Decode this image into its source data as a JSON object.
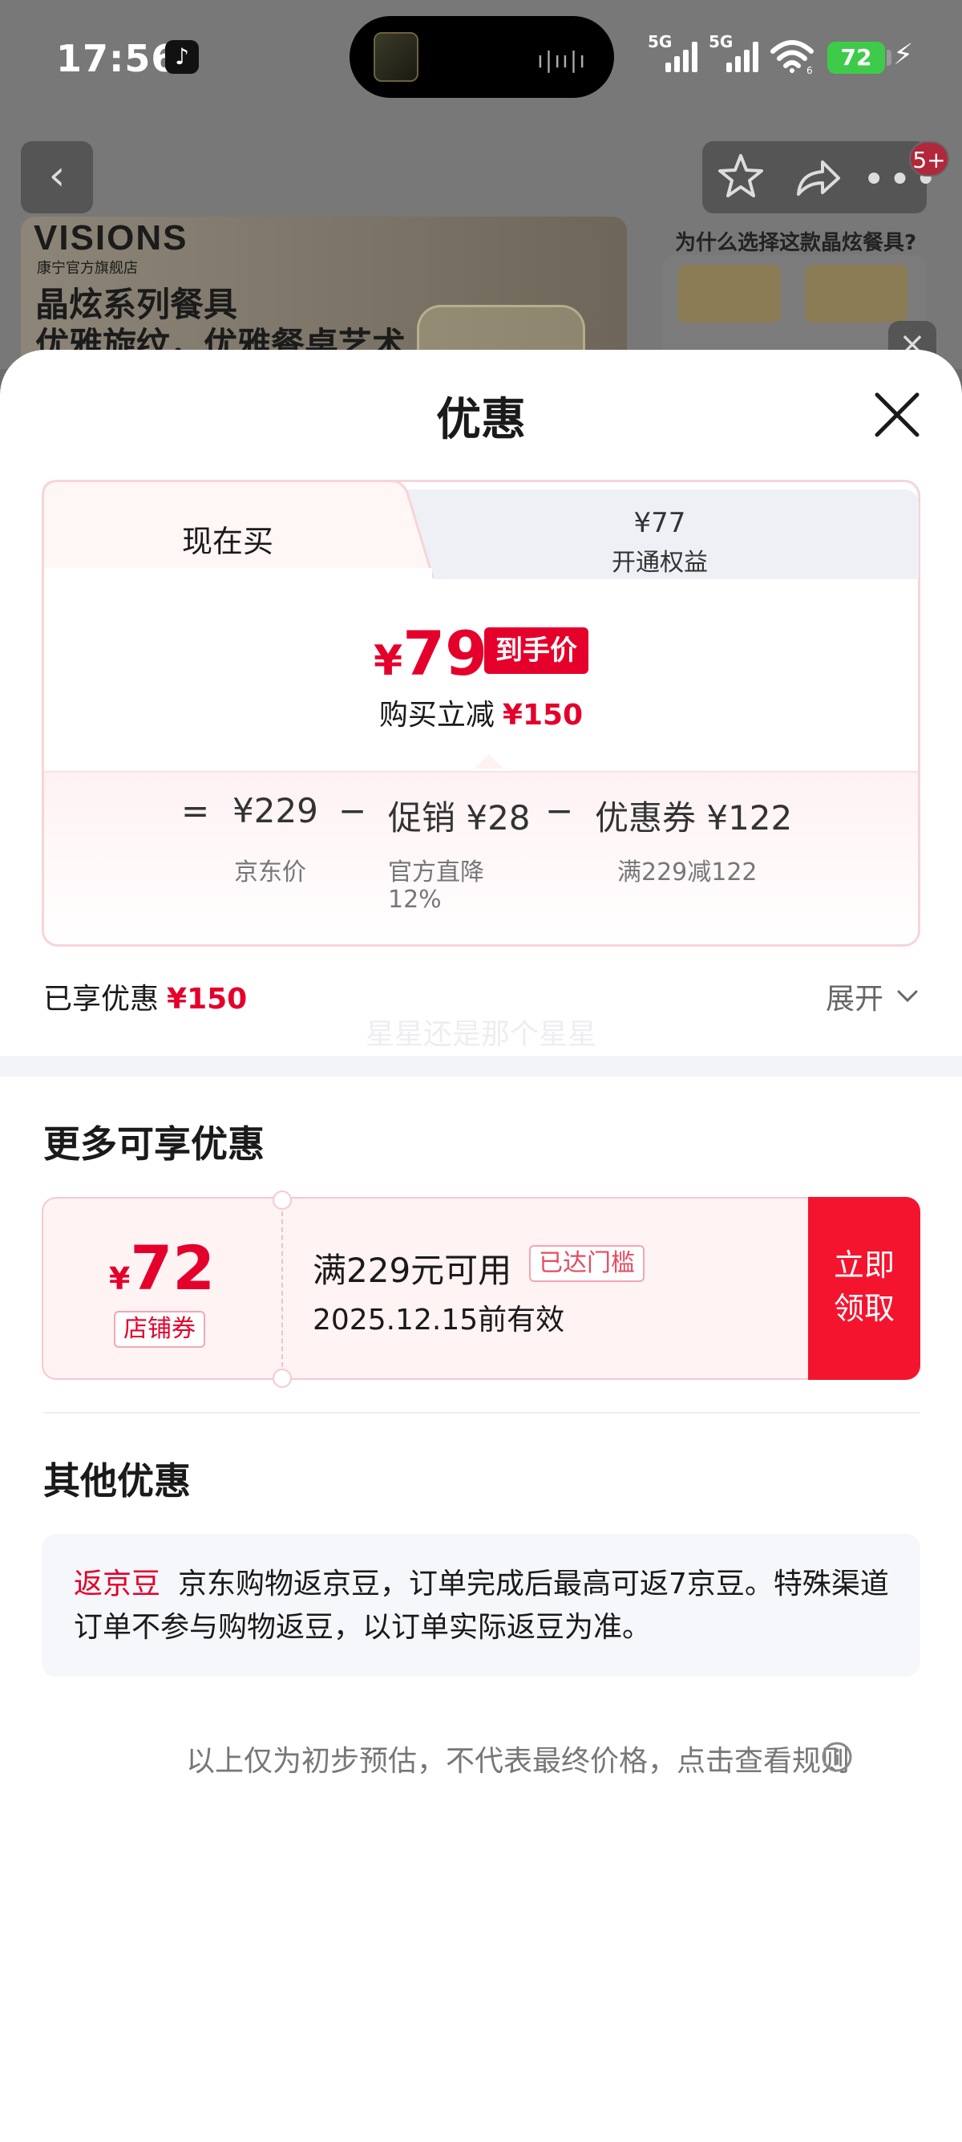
{
  "status_bar": {
    "time": "17:56",
    "signal_1": "5G",
    "signal_2": "5G",
    "wifi_badge": "6",
    "battery": "72"
  },
  "background": {
    "brand_logo": "VISIONS",
    "brand_sub": "康宁官方旗舰店",
    "banner_title_1": "晶炫系列餐具",
    "banner_title_2": "优雅旋纹，优雅餐桌艺术",
    "why_title": "为什么选择这款晶炫餐具?",
    "message_badge": "5+"
  },
  "sheet": {
    "title": "优惠",
    "tabs": [
      {
        "label": "现在买"
      },
      {
        "price": "¥77",
        "label": "开通权益"
      }
    ],
    "final_price_symbol": "¥",
    "final_price_value": "79",
    "final_price_badge": "到手价",
    "save_label": "购买立减",
    "save_amount": "¥150",
    "calculation": {
      "equals": "=",
      "minus": "−",
      "base_value": "¥229",
      "base_label": "京东价",
      "promo_value": "促销 ¥28",
      "promo_label_1": "官方直降",
      "promo_label_2": "12%",
      "coupon_value": "优惠券 ¥122",
      "coupon_label": "满229减122"
    },
    "enjoyed_label": "已享优惠",
    "enjoyed_amount": "¥150",
    "expand_label": "展开",
    "watermark": "星星还是那个星星"
  },
  "more_discounts": {
    "title": "更多可享优惠",
    "coupon": {
      "symbol": "¥",
      "amount": "72",
      "type": "店铺券",
      "condition": "满229元可用",
      "tag": "已达门槛",
      "expiry": "2025.12.15前有效",
      "claim_line_1": "立即",
      "claim_line_2": "领取"
    }
  },
  "other_discounts": {
    "title": "其他优惠",
    "jd_label": "返京豆",
    "jd_text": "京东购物返京豆，订单完成后最高可返7京豆。特殊渠道订单不参与购物返豆，以订单实际返豆为准。"
  },
  "disclaimer": "以上仅为初步预估，不代表最终价格，点击查看规则",
  "colors": {
    "accent_red": "#e4002b",
    "claim_red": "#f5142e",
    "coupon_bg": "#fff3f4",
    "battery_green": "#3ecb4a"
  }
}
